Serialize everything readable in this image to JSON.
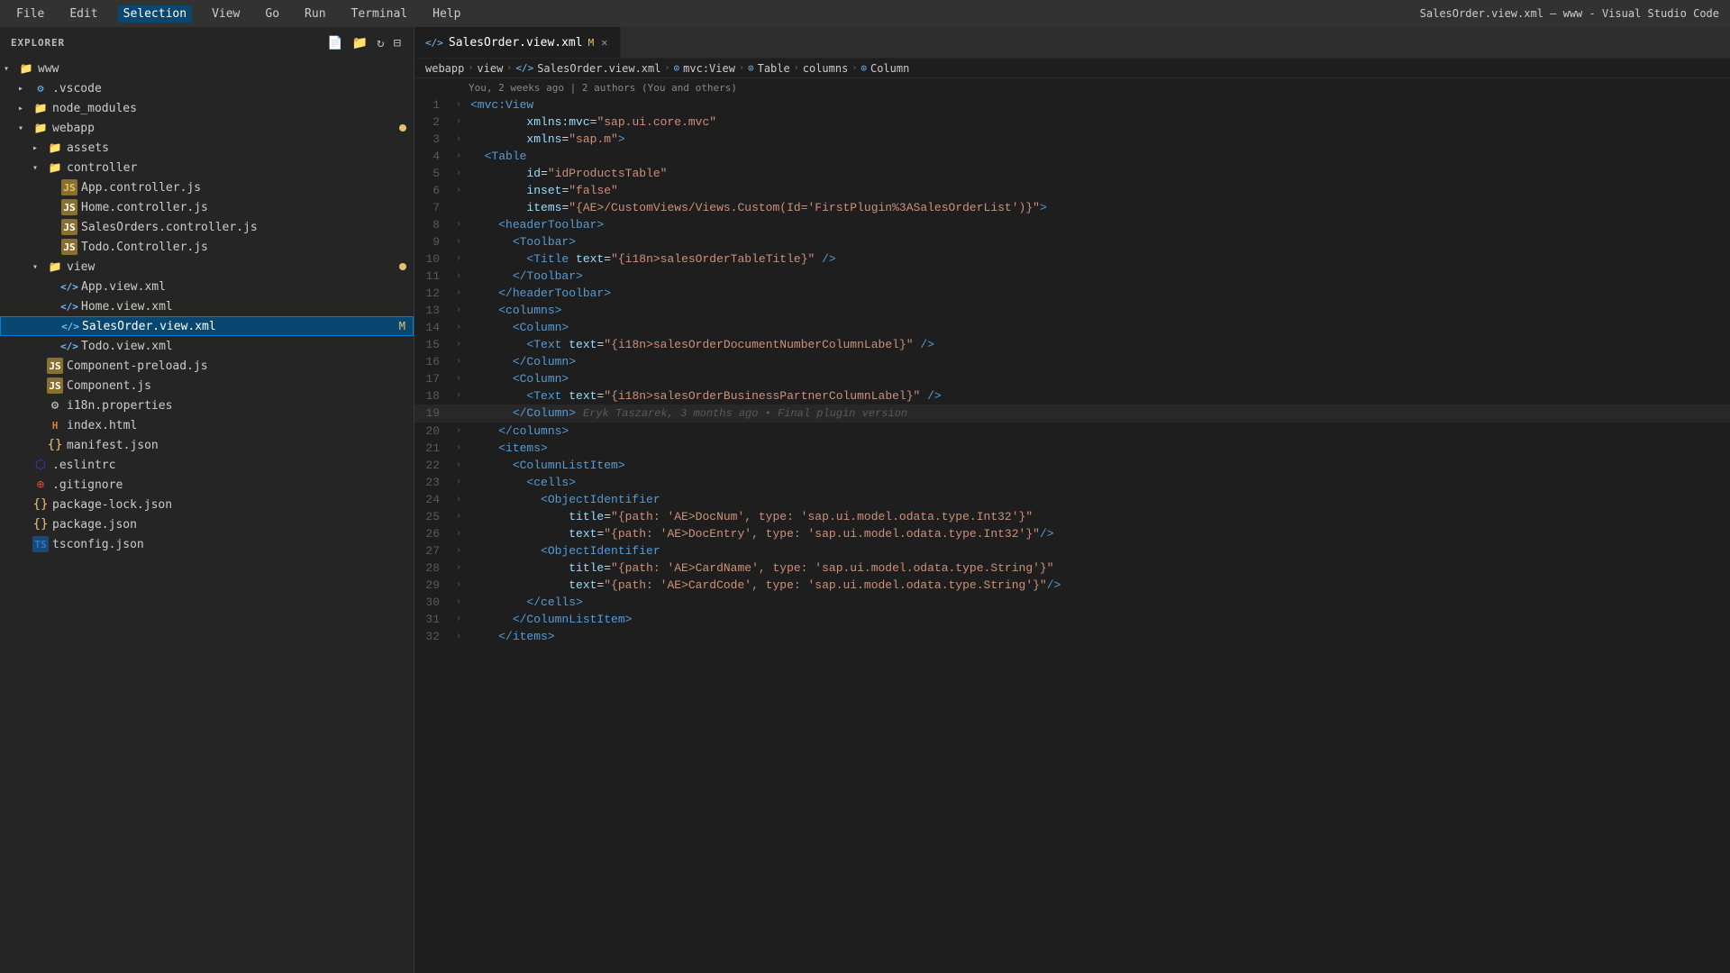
{
  "titlebar": {
    "menu_items": [
      "File",
      "Edit",
      "Selection",
      "View",
      "Go",
      "Run",
      "Terminal",
      "Help"
    ],
    "active_item": "Selection",
    "window_title": "SalesOrder.view.xml — www - Visual Studio Code"
  },
  "sidebar": {
    "header": "EXPLORER",
    "root": "www",
    "tree": [
      {
        "id": "www",
        "label": "www",
        "indent": 0,
        "type": "root-folder",
        "open": true
      },
      {
        "id": "vscode",
        "label": ".vscode",
        "indent": 1,
        "type": "folder",
        "open": false
      },
      {
        "id": "node_modules",
        "label": "node_modules",
        "indent": 1,
        "type": "folder",
        "open": false
      },
      {
        "id": "webapp",
        "label": "webapp",
        "indent": 1,
        "type": "folder",
        "open": true,
        "modified": true
      },
      {
        "id": "assets",
        "label": "assets",
        "indent": 2,
        "type": "folder",
        "open": false
      },
      {
        "id": "controller",
        "label": "controller",
        "indent": 2,
        "type": "folder",
        "open": true
      },
      {
        "id": "app-ctrl",
        "label": "App.controller.js",
        "indent": 3,
        "type": "js"
      },
      {
        "id": "home-ctrl",
        "label": "Home.controller.js",
        "indent": 3,
        "type": "js"
      },
      {
        "id": "sales-ctrl",
        "label": "SalesOrders.controller.js",
        "indent": 3,
        "type": "js"
      },
      {
        "id": "todo-ctrl",
        "label": "Todo.Controller.js",
        "indent": 3,
        "type": "js"
      },
      {
        "id": "view",
        "label": "view",
        "indent": 2,
        "type": "folder",
        "open": true,
        "modified": true
      },
      {
        "id": "app-view",
        "label": "App.view.xml",
        "indent": 3,
        "type": "xml"
      },
      {
        "id": "home-view",
        "label": "Home.view.xml",
        "indent": 3,
        "type": "xml"
      },
      {
        "id": "sales-view",
        "label": "SalesOrder.view.xml",
        "indent": 3,
        "type": "xml-active",
        "active": true,
        "modified_marker": "M"
      },
      {
        "id": "todo-view",
        "label": "Todo.view.xml",
        "indent": 3,
        "type": "xml"
      },
      {
        "id": "comp-preload",
        "label": "Component-preload.js",
        "indent": 2,
        "type": "js"
      },
      {
        "id": "component",
        "label": "Component.js",
        "indent": 2,
        "type": "js"
      },
      {
        "id": "i18n",
        "label": "i18n.properties",
        "indent": 2,
        "type": "settings"
      },
      {
        "id": "index-html",
        "label": "index.html",
        "indent": 2,
        "type": "html"
      },
      {
        "id": "manifest",
        "label": "manifest.json",
        "indent": 2,
        "type": "json"
      },
      {
        "id": "eslintrc",
        "label": ".eslintrc",
        "indent": 1,
        "type": "eslint"
      },
      {
        "id": "gitignore",
        "label": ".gitignore",
        "indent": 1,
        "type": "git"
      },
      {
        "id": "pkg-lock",
        "label": "package-lock.json",
        "indent": 1,
        "type": "pkg-lock"
      },
      {
        "id": "package",
        "label": "package.json",
        "indent": 1,
        "type": "json"
      },
      {
        "id": "tsconfig",
        "label": "tsconfig.json",
        "indent": 1,
        "type": "ts"
      }
    ]
  },
  "tab": {
    "filename": "SalesOrder.view.xml",
    "prefix": "</>",
    "modified_label": "M"
  },
  "breadcrumb": {
    "items": [
      "webapp",
      ">",
      "</>",
      "SalesOrder.view.xml",
      ">",
      "mvc:View",
      ">",
      "Table",
      ">",
      "columns",
      ">",
      "Column"
    ]
  },
  "blame_header": "You, 2 weeks ago | 2 authors (You and others)",
  "code_lines": [
    {
      "num": 1,
      "tokens": [
        {
          "t": "<",
          "c": "xml-tag"
        },
        {
          "t": "mvc:View",
          "c": "xml-tag"
        }
      ]
    },
    {
      "num": 2,
      "tokens": [
        {
          "t": "    xmlns:mvc=",
          "c": "xml-attr"
        },
        {
          "t": "\"sap.ui.core.mvc\"",
          "c": "xml-value"
        }
      ]
    },
    {
      "num": 3,
      "tokens": [
        {
          "t": "    xmlns=",
          "c": "xml-attr"
        },
        {
          "t": "\"sap.m\"",
          "c": "xml-value"
        },
        {
          "t": ">",
          "c": "xml-tag"
        }
      ]
    },
    {
      "num": 4,
      "tokens": [
        {
          "t": "  <Table",
          "c": "xml-tag"
        }
      ]
    },
    {
      "num": 5,
      "tokens": [
        {
          "t": "    id=",
          "c": "xml-attr"
        },
        {
          "t": "\"idProductsTable\"",
          "c": "xml-value"
        }
      ]
    },
    {
      "num": 6,
      "tokens": [
        {
          "t": "    inset=",
          "c": "xml-attr"
        },
        {
          "t": "\"false\"",
          "c": "xml-value"
        }
      ]
    },
    {
      "num": 7,
      "tokens": [
        {
          "t": "    items=",
          "c": "xml-attr"
        },
        {
          "t": "\"{AE>/CustomViews/Views.Custom(Id='FirstPlugin%3ASalesOrderList')}\"",
          "c": "xml-value"
        },
        {
          "t": ">",
          "c": "xml-tag"
        }
      ]
    },
    {
      "num": 8,
      "tokens": [
        {
          "t": "    <headerToolbar>",
          "c": "xml-tag"
        }
      ]
    },
    {
      "num": 9,
      "tokens": [
        {
          "t": "      <Toolbar>",
          "c": "xml-tag"
        }
      ]
    },
    {
      "num": 10,
      "tokens": [
        {
          "t": "        <Title ",
          "c": "xml-tag"
        },
        {
          "t": "text=",
          "c": "xml-attr"
        },
        {
          "t": "\"{i18n>salesOrderTableTitle}\"",
          "c": "xml-value"
        },
        {
          "t": "/>",
          "c": "xml-tag"
        }
      ]
    },
    {
      "num": 11,
      "tokens": [
        {
          "t": "      </Toolbar>",
          "c": "xml-tag"
        }
      ]
    },
    {
      "num": 12,
      "tokens": [
        {
          "t": "    </headerToolbar>",
          "c": "xml-tag"
        }
      ]
    },
    {
      "num": 13,
      "tokens": [
        {
          "t": "    <columns>",
          "c": "xml-tag"
        }
      ]
    },
    {
      "num": 14,
      "tokens": [
        {
          "t": "      <Column>",
          "c": "xml-tag"
        }
      ]
    },
    {
      "num": 15,
      "tokens": [
        {
          "t": "        <Text ",
          "c": "xml-tag"
        },
        {
          "t": "text=",
          "c": "xml-attr"
        },
        {
          "t": "\"{i18n>salesOrderDocumentNumberColumnLabel}\"",
          "c": "xml-value"
        },
        {
          "t": "/>",
          "c": "xml-tag"
        }
      ]
    },
    {
      "num": 16,
      "tokens": [
        {
          "t": "      </Column>",
          "c": "xml-tag"
        }
      ]
    },
    {
      "num": 17,
      "tokens": [
        {
          "t": "      <Column>",
          "c": "xml-tag"
        }
      ]
    },
    {
      "num": 18,
      "tokens": [
        {
          "t": "        <Text ",
          "c": "xml-tag"
        },
        {
          "t": "text=",
          "c": "xml-attr"
        },
        {
          "t": "\"{i18n>salesOrderBusinessPartnerColumnLabel}\"",
          "c": "xml-value"
        },
        {
          "t": "/>",
          "c": "xml-tag"
        }
      ]
    },
    {
      "num": 19,
      "tokens": [
        {
          "t": "      </Column>",
          "c": "xml-tag"
        }
      ],
      "inline_blame": "Eryk Taszarek, 3 months ago • Final plugin version"
    },
    {
      "num": 20,
      "tokens": [
        {
          "t": "    </columns>",
          "c": "xml-tag"
        }
      ]
    },
    {
      "num": 21,
      "tokens": [
        {
          "t": "    <items>",
          "c": "xml-tag"
        }
      ]
    },
    {
      "num": 22,
      "tokens": [
        {
          "t": "      <ColumnListItem>",
          "c": "xml-tag"
        }
      ]
    },
    {
      "num": 23,
      "tokens": [
        {
          "t": "        <cells>",
          "c": "xml-tag"
        }
      ]
    },
    {
      "num": 24,
      "tokens": [
        {
          "t": "          <ObjectIdentifier",
          "c": "xml-tag"
        }
      ]
    },
    {
      "num": 25,
      "tokens": [
        {
          "t": "            title=",
          "c": "xml-attr"
        },
        {
          "t": "\"{path: 'AE>DocNum', type: 'sap.ui.model.odata.type.Int32'}\"",
          "c": "xml-value"
        }
      ]
    },
    {
      "num": 26,
      "tokens": [
        {
          "t": "            text=",
          "c": "xml-attr"
        },
        {
          "t": "\"{path: 'AE>DocEntry', type: 'sap.ui.model.odata.type.Int32'}\"",
          "c": "xml-value"
        },
        {
          "t": "/>",
          "c": "xml-tag"
        }
      ]
    },
    {
      "num": 27,
      "tokens": [
        {
          "t": "          <ObjectIdentifier",
          "c": "xml-tag"
        }
      ]
    },
    {
      "num": 28,
      "tokens": [
        {
          "t": "            title=",
          "c": "xml-attr"
        },
        {
          "t": "\"{path: 'AE>CardName', type: 'sap.ui.model.odata.type.String'}\"",
          "c": "xml-value"
        }
      ]
    },
    {
      "num": 29,
      "tokens": [
        {
          "t": "            text=",
          "c": "xml-attr"
        },
        {
          "t": "\"{path: 'AE>CardCode', type: 'sap.ui.model.odata.type.String'}\"",
          "c": "xml-value"
        },
        {
          "t": "/>",
          "c": "xml-tag"
        }
      ]
    },
    {
      "num": 30,
      "tokens": [
        {
          "t": "        </cells>",
          "c": "xml-tag"
        }
      ]
    },
    {
      "num": 31,
      "tokens": [
        {
          "t": "      </ColumnListItem>",
          "c": "xml-tag"
        }
      ]
    },
    {
      "num": 32,
      "tokens": [
        {
          "t": "    </items>",
          "c": "xml-tag"
        }
      ]
    }
  ]
}
